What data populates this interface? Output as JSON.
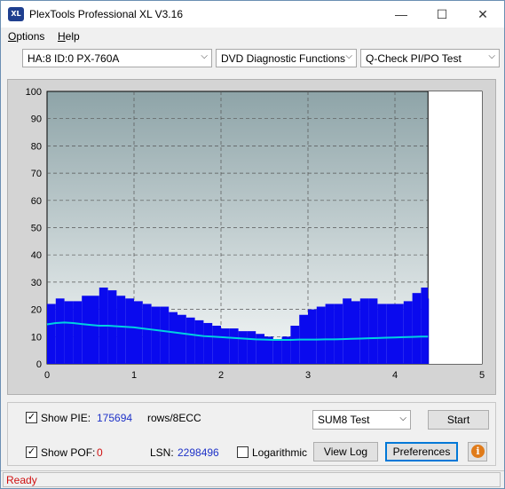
{
  "window": {
    "title": "PlexTools Professional XL V3.16",
    "icon_text": "XL",
    "controls": {
      "minimize": "—",
      "maximize": "☐",
      "close": "✕"
    }
  },
  "menu": {
    "items": [
      {
        "label": "Options",
        "underline": "O",
        "rest": "ptions"
      },
      {
        "label": "Help",
        "underline": "H",
        "rest": "elp"
      }
    ]
  },
  "toolbar": {
    "drive": "HA:8 ID:0  PX-760A",
    "function": "DVD Diagnostic Functions",
    "test": "Q-Check PI/PO Test"
  },
  "chart_data": {
    "type": "area",
    "x_ticks": [
      "0",
      "1",
      "2",
      "3",
      "4",
      "5"
    ],
    "y_ticks": [
      "0",
      "10",
      "20",
      "30",
      "40",
      "50",
      "60",
      "70",
      "80",
      "90",
      "100"
    ],
    "xlim": [
      0,
      5
    ],
    "ylim": [
      0,
      100
    ],
    "grid": true,
    "data_end_x": 4.38,
    "series": [
      {
        "kind": "pie_bars",
        "color": "#0a0aee",
        "x": [
          0,
          0.1,
          0.2,
          0.3,
          0.4,
          0.5,
          0.6,
          0.7,
          0.8,
          0.9,
          1.0,
          1.1,
          1.2,
          1.3,
          1.4,
          1.5,
          1.6,
          1.7,
          1.8,
          1.9,
          2.0,
          2.1,
          2.2,
          2.3,
          2.4,
          2.5,
          2.6,
          2.7,
          2.8,
          2.9,
          3.0,
          3.1,
          3.2,
          3.3,
          3.4,
          3.5,
          3.6,
          3.7,
          3.8,
          3.9,
          4.0,
          4.1,
          4.2,
          4.3,
          4.38
        ],
        "values": [
          22,
          24,
          23,
          23,
          25,
          25,
          28,
          27,
          25,
          24,
          23,
          22,
          21,
          21,
          19,
          18,
          17,
          16,
          15,
          14,
          13,
          13,
          12,
          12,
          11,
          10,
          9,
          10,
          14,
          18,
          20,
          21,
          22,
          22,
          24,
          23,
          24,
          24,
          22,
          22,
          22,
          23,
          26,
          28,
          24
        ]
      },
      {
        "kind": "sum8_line",
        "color": "#00d0e0",
        "x": [
          0,
          0.1,
          0.2,
          0.3,
          0.4,
          0.5,
          0.6,
          0.7,
          0.8,
          0.9,
          1.0,
          1.1,
          1.2,
          1.3,
          1.4,
          1.5,
          1.6,
          1.7,
          1.8,
          1.9,
          2.0,
          2.1,
          2.2,
          2.3,
          2.4,
          2.5,
          2.6,
          2.7,
          2.8,
          2.9,
          3.0,
          3.1,
          3.2,
          3.3,
          3.4,
          3.5,
          3.6,
          3.7,
          3.8,
          3.9,
          4.0,
          4.1,
          4.2,
          4.3,
          4.38
        ],
        "values": [
          14.5,
          15,
          15.2,
          15,
          14.6,
          14.3,
          14,
          14,
          13.8,
          13.6,
          13.4,
          13,
          12.6,
          12.2,
          11.8,
          11.4,
          11,
          10.6,
          10.2,
          10,
          9.8,
          9.6,
          9.4,
          9.2,
          9,
          8.9,
          8.8,
          8.8,
          8.8,
          8.9,
          8.9,
          8.9,
          9,
          9,
          9.1,
          9.2,
          9.3,
          9.4,
          9.5,
          9.6,
          9.7,
          9.8,
          9.9,
          10,
          10
        ]
      }
    ]
  },
  "controls": {
    "show_pie_label": "Show PIE:",
    "show_pie_checked": "✓",
    "pie_value": "175694",
    "rows_label": "rows/8ECC",
    "show_pof_label": "Show POF:",
    "show_pof_checked": "✓",
    "pof_value": "0",
    "lsn_label": "LSN:",
    "lsn_value": "2298496",
    "logarithmic_label": "Logarithmic",
    "mode_select": "SUM8 Test",
    "start_button": "Start",
    "view_log_button": "View Log",
    "preferences_button": "Preferences",
    "info_icon": "i"
  },
  "status": {
    "text": "Ready"
  }
}
